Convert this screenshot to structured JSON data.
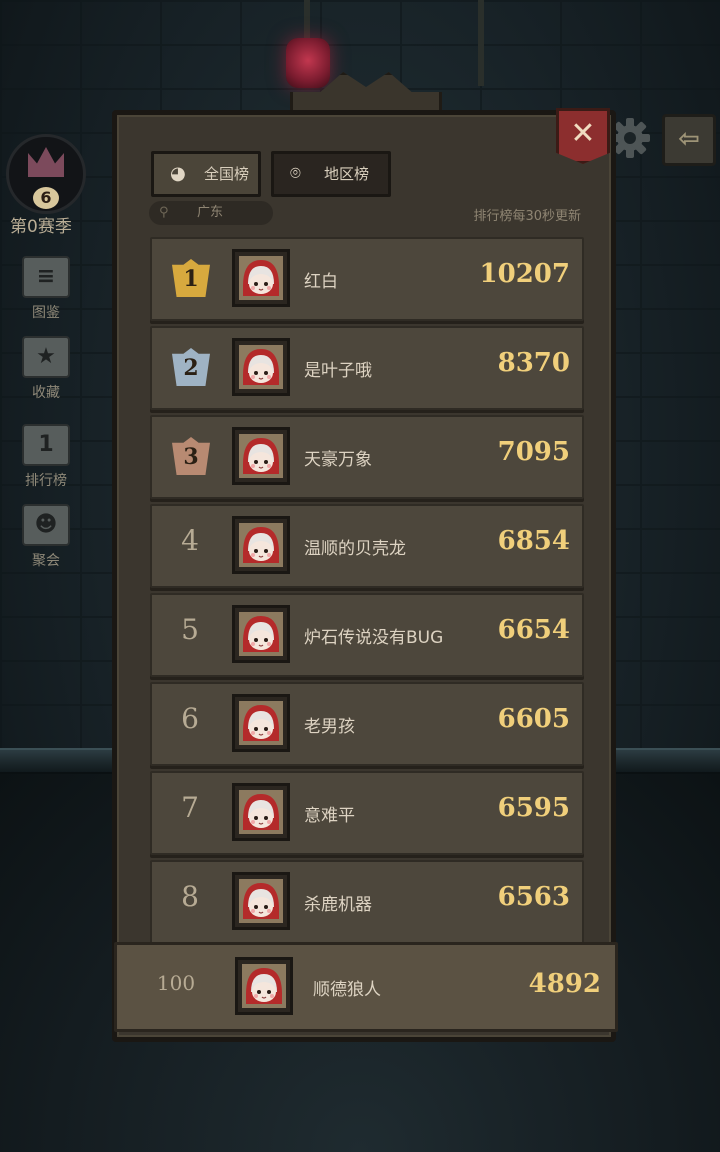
{
  "season": {
    "level": "6",
    "label": "第0赛季"
  },
  "left_menu": [
    {
      "label": "图鉴",
      "icon": "book-stack-icon"
    },
    {
      "label": "收藏",
      "icon": "star-card-icon"
    },
    {
      "label": "排行榜",
      "icon": "podium-icon",
      "glyph": "1"
    },
    {
      "label": "聚会",
      "icon": "people-icon"
    }
  ],
  "buttons": {
    "close": "✕",
    "exit": "⇦"
  },
  "tabs": [
    {
      "label": "全国榜",
      "icon": "globe-icon",
      "active": false
    },
    {
      "label": "地区榜",
      "icon": "location-pin-icon",
      "active": true
    }
  ],
  "region": {
    "value": "广东"
  },
  "update_note": "排行榜每30秒更新",
  "ranking": [
    {
      "rank": "1",
      "name": "红白",
      "score": "10207"
    },
    {
      "rank": "2",
      "name": "是叶子哦",
      "score": "8370"
    },
    {
      "rank": "3",
      "name": "天豪万象",
      "score": "7095"
    },
    {
      "rank": "4",
      "name": "温顺的贝壳龙",
      "score": "6854"
    },
    {
      "rank": "5",
      "name": "炉石传说没有BUG",
      "score": "6654"
    },
    {
      "rank": "6",
      "name": "老男孩",
      "score": "6605"
    },
    {
      "rank": "7",
      "name": "意难平",
      "score": "6595"
    },
    {
      "rank": "8",
      "name": "杀鹿机器",
      "score": "6563"
    }
  ],
  "self": {
    "rank": "100",
    "name": "顺德狼人",
    "score": "4892"
  },
  "colors": {
    "gold": "#d7a93e",
    "silver": "#9fb3c4",
    "bronze": "#b88a72",
    "score": "#f0cf7b",
    "accent_red": "#8c2e2e"
  }
}
